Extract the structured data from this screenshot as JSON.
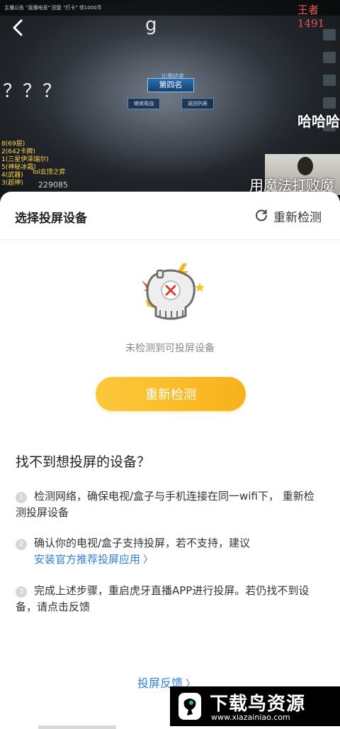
{
  "video": {
    "top_strip_text": "主播公告 \"直播电竞\" 回复 \"打卡\" 领1000币",
    "top_right_text": "王者1491",
    "hud_letter": "g",
    "rank_tag": "比赛结束",
    "rank_label": "第四名",
    "rank_btn_left": "继续观战",
    "rank_btn_right": "返回列表",
    "question_marks": "？？？",
    "left_list": [
      "8(69层)",
      "2(642卡牌)",
      "1(三星伊泽瑞尔)",
      "5(神秘冰霜)",
      "4(武器)",
      "3(超神)"
    ],
    "left_gray": "lol云顶之弈",
    "left_num": "229085",
    "danmaku_1": "哈哈哈",
    "danmaku_2": "用魔法打败魔"
  },
  "sheet": {
    "title": "选择投屏设备",
    "redetect_link": "重新检测",
    "empty_text": "未检测到可投屏设备",
    "primary_button": "重新检测",
    "help_title": "找不到想投屏的设备？",
    "steps": [
      {
        "num": "1",
        "text": "检测网络，确保电视/盒子与手机连接在同一wifi下， 重新检测投屏设备"
      },
      {
        "num": "2",
        "text": "确认你的电视/盒子支持投屏，若不支持，建议",
        "link": "安装官方推荐投屏应用"
      },
      {
        "num": "3",
        "text": "完成上述步骤，重启虎牙直播APP进行投屏。若仍找不到设备，请点击反馈"
      }
    ],
    "feedback_link": "投屏反馈"
  },
  "watermark": {
    "main": "下载鸟资源",
    "sub": "www.xiazainiao.com"
  },
  "colors": {
    "accent_yellow": "#f8b21a",
    "link_blue": "#2f7fd8"
  },
  "icons": [
    "back-icon",
    "refresh-icon",
    "chevron-right-icon"
  ]
}
